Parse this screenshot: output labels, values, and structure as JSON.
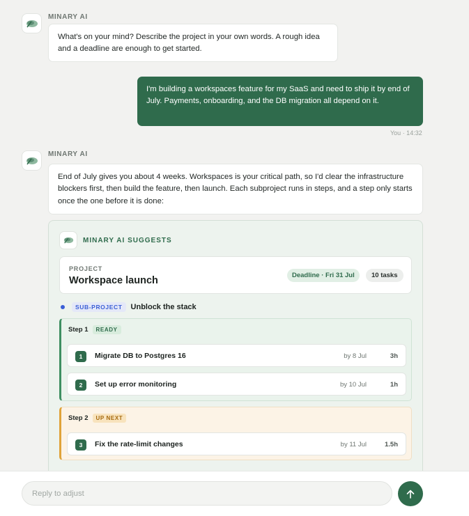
{
  "assistant_name": "MINARY AI",
  "messages": [
    {
      "sender": "MINARY AI",
      "text": "What's on your mind? Describe the project in your own words. A rough idea and a deadline are enough to get started."
    },
    {
      "sender": "You",
      "text": "I'm building a workspaces feature for my SaaS and need to ship it by end of July. Payments, onboarding, and the DB migration all depend on it.",
      "meta": "You · 14:32"
    },
    {
      "sender": "MINARY AI",
      "text": "End of July gives you about 4 weeks. Workspaces is your critical path, so I'd clear the infrastructure blockers first, then build the feature, then launch. Each subproject runs in steps, and a step only starts once the one before it is done:"
    }
  ],
  "suggestion": {
    "title": "MINARY AI SUGGESTS",
    "project_label": "PROJECT",
    "project_name": "Workspace launch",
    "deadline": "Deadline · Fri 31 Jul",
    "tasks_count": "10 tasks",
    "subproject": {
      "badge": "SUB-PROJECT",
      "name": "Unblock the stack",
      "steps": [
        {
          "label": "Step 1",
          "status": "READY",
          "tasks": [
            {
              "num": "1",
              "name": "Migrate DB to Postgres 16",
              "due": "by 8 Jul",
              "est": "3h"
            },
            {
              "num": "2",
              "name": "Set up error monitoring",
              "due": "by 10 Jul",
              "est": "1h"
            }
          ]
        },
        {
          "label": "Step 2",
          "status": "UP NEXT",
          "tasks": [
            {
              "num": "3",
              "name": "Fix the rate-limit changes",
              "due": "by 11 Jul",
              "est": "1.5h"
            }
          ]
        }
      ]
    }
  },
  "composer": {
    "placeholder": "Reply to adjust",
    "value": ""
  },
  "icons": {
    "avatar": "minary-logo-icon",
    "send": "arrow-up-icon"
  },
  "colors": {
    "brand": "#2f6b4c",
    "ready": "#3f8f62",
    "up_next": "#e0a33a",
    "subproject": "#3a5fd6"
  }
}
